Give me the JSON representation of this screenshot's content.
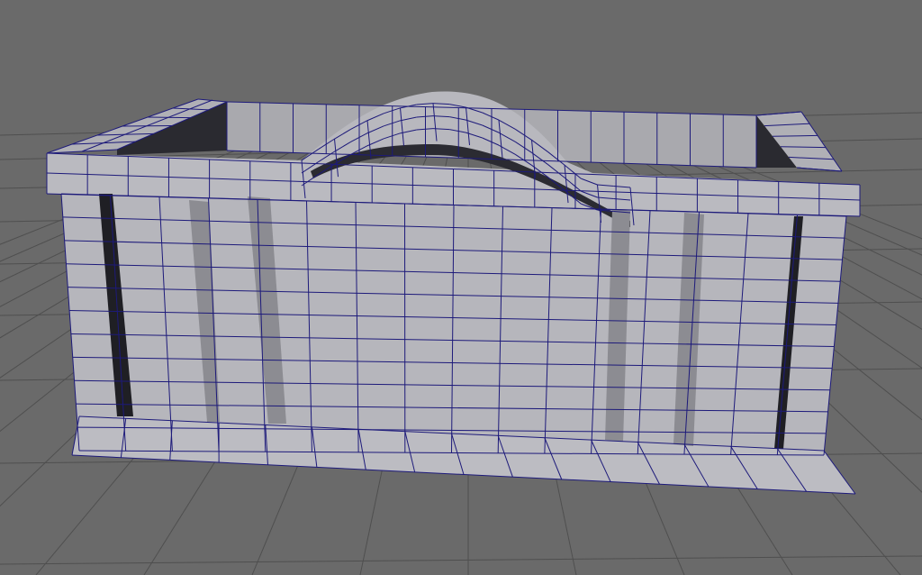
{
  "viewport": {
    "background": "#6a6a6a",
    "grid_line_color": "#4f4f4f",
    "mesh_face_color": "#b4b4b8",
    "mesh_face_shade": "#9e9ea4",
    "mesh_side_color": "#8c8c92",
    "mesh_inner_color": "#2a2a30",
    "wireframe_color": "#1d1a7a"
  },
  "model": {
    "object": "wall-planter-mesh",
    "face_columns_front": 16,
    "face_rows_front": 11,
    "raised_arch": true,
    "open_top": true
  }
}
